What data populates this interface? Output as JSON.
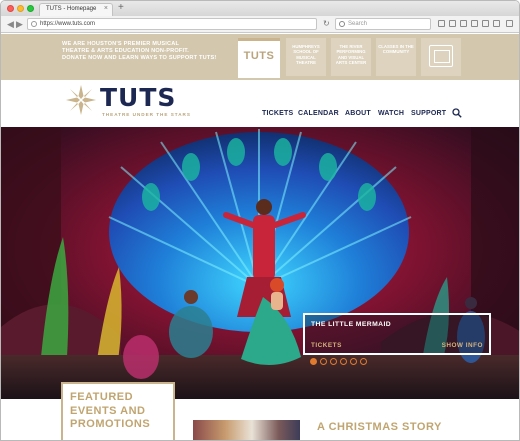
{
  "browser": {
    "tab_title": "TUTS - Homepage",
    "tab_close": "×",
    "new_tab": "+",
    "url": "https://www.tuts.com",
    "search_placeholder": "Search"
  },
  "utility": {
    "promo_line1": "WE ARE HOUSTON'S PREMIER MUSICAL",
    "promo_line2": "THEATRE & ARTS EDUCATION NON-PROFIT.",
    "donate": "DONATE NOW",
    "and": " AND ",
    "learn": "LEARN WAYS TO SUPPORT TUTS!",
    "tabs": [
      {
        "label": "TUTS"
      },
      {
        "label": "HUMPHREYS SCHOOL OF MUSICAL THEATRE"
      },
      {
        "label": "THE RIVER PERFORMING AND VISUAL ARTS CENTER"
      },
      {
        "label": "CLASSES IN THE COMMUNITY"
      }
    ]
  },
  "header": {
    "logo_word": "TUTS",
    "logo_tagline": "THEATRE UNDER THE STARS",
    "nav": [
      {
        "label": "TICKETS"
      },
      {
        "label": "CALENDAR"
      },
      {
        "label": "ABOUT"
      },
      {
        "label": "WATCH"
      },
      {
        "label": "SUPPORT"
      }
    ]
  },
  "hero": {
    "show_title": "THE LITTLE MERMAID",
    "tickets_label": "TICKETS",
    "info_label": "SHOW INFO",
    "carousel_dots": 6,
    "active_dot": 0
  },
  "sections": {
    "featured_title": "FEATURED EVENTS AND PROMOTIONS",
    "promo_title": "A CHRISTMAS STORY"
  },
  "colors": {
    "navy": "#1c2752",
    "gold": "#c0a570",
    "accent_orange": "#e07a2f",
    "utility_bg": "#d3c7ae"
  }
}
